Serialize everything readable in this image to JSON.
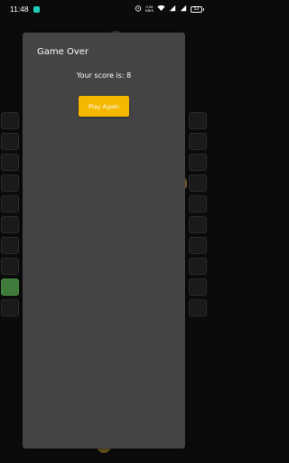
{
  "status_bar": {
    "time": "11:48",
    "speed_value": "0.00",
    "speed_unit": "KB/S",
    "battery": "53"
  },
  "dialog": {
    "title": "Game Over",
    "score_text": "Your score is: 8",
    "play_again_label": "Play Again"
  },
  "colors": {
    "dialog_bg": "#444444",
    "button": "#f5b800",
    "green_tile": "#3f7b3a",
    "background": "#0b0b0b"
  }
}
